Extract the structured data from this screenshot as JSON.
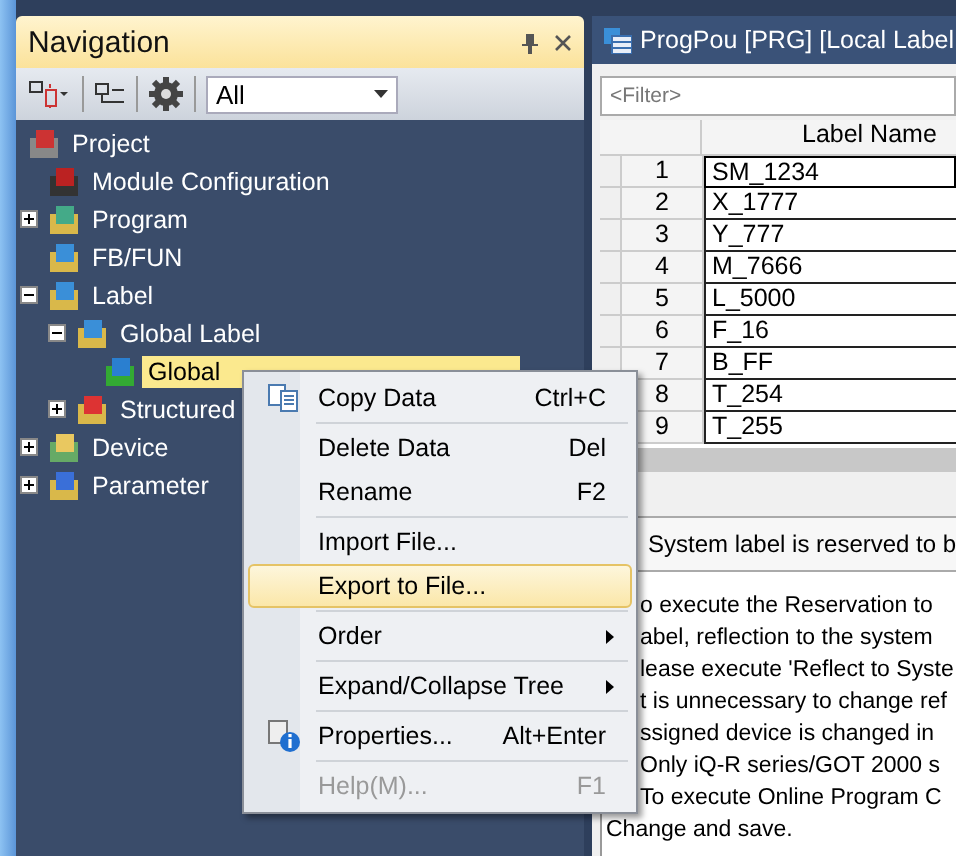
{
  "navigation": {
    "title": "Navigation",
    "toolbar": {
      "filter_value": "All"
    },
    "tree": [
      {
        "label": "Project",
        "children": [
          {
            "label": "Module Configuration",
            "selected": false
          },
          {
            "label": "Program",
            "expanded": false,
            "selected": false
          },
          {
            "label": "FB/FUN",
            "selected": false
          },
          {
            "label": "Label",
            "expanded": true,
            "selected": false,
            "children": [
              {
                "label": "Global Label",
                "expanded": true,
                "selected": false,
                "children": [
                  {
                    "label": "Global",
                    "selected": true
                  }
                ]
              },
              {
                "label": "Structured",
                "expanded": false,
                "selected": false
              }
            ]
          },
          {
            "label": "Device",
            "expanded": false,
            "selected": false
          },
          {
            "label": "Parameter",
            "expanded": false,
            "selected": false
          }
        ]
      }
    ]
  },
  "editor": {
    "tab_title": "ProgPou [PRG] [Local Label",
    "filter_placeholder": "<Filter>",
    "table": {
      "columns": [
        "Label Name"
      ],
      "rows": [
        {
          "number": "1",
          "label_name": "SM_1234",
          "selected": true
        },
        {
          "number": "2",
          "label_name": "X_1777",
          "selected": false
        },
        {
          "number": "3",
          "label_name": "Y_777",
          "selected": false
        },
        {
          "number": "4",
          "label_name": "M_7666",
          "selected": false
        },
        {
          "number": "5",
          "label_name": "L_5000",
          "selected": false
        },
        {
          "number": "6",
          "label_name": "F_16",
          "selected": false
        },
        {
          "number": "7",
          "label_name": "B_FF",
          "selected": false
        },
        {
          "number": "8",
          "label_name": "T_254",
          "selected": false
        },
        {
          "number": "9",
          "label_name": "T_255",
          "selected": false
        }
      ]
    },
    "system_label_message": "System label is reserved to b",
    "notes": [
      "o execute the Reservation to",
      "abel, reflection to the system",
      "lease execute 'Reflect to Syste",
      "t is unnecessary to change ref",
      "ssigned device is changed in",
      "Only iQ-R series/GOT 2000 s",
      "To execute Online Program C",
      "Change and save."
    ]
  },
  "context_menu": [
    {
      "kind": "item",
      "label": "Copy Data",
      "shortcut": "Ctrl+C",
      "selected": false,
      "disabled": false
    },
    {
      "kind": "separator"
    },
    {
      "kind": "item",
      "label": "Delete Data",
      "shortcut": "Del",
      "selected": false,
      "disabled": false
    },
    {
      "kind": "item",
      "label": "Rename",
      "shortcut": "F2",
      "selected": false,
      "disabled": false
    },
    {
      "kind": "separator"
    },
    {
      "kind": "item",
      "label": "Import File...",
      "selected": false,
      "disabled": false
    },
    {
      "kind": "item",
      "label": "Export to File...",
      "selected": true,
      "disabled": false
    },
    {
      "kind": "separator"
    },
    {
      "kind": "submenu",
      "label": "Order",
      "selected": false,
      "disabled": false
    },
    {
      "kind": "separator"
    },
    {
      "kind": "submenu",
      "label": "Expand/Collapse Tree",
      "selected": false,
      "disabled": false
    },
    {
      "kind": "separator"
    },
    {
      "kind": "item",
      "label": "Properties...",
      "shortcut": "Alt+Enter",
      "selected": false,
      "disabled": false
    },
    {
      "kind": "separator"
    },
    {
      "kind": "item",
      "label": "Help(M)...",
      "shortcut": "F1",
      "selected": false,
      "disabled": true
    }
  ]
}
